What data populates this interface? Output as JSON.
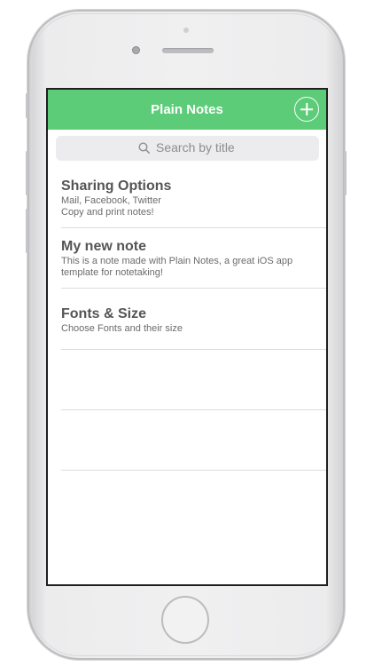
{
  "app": {
    "title": "Plain Notes"
  },
  "search": {
    "placeholder": "Search by title"
  },
  "notes": [
    {
      "title": "Sharing Options",
      "lines": [
        "Mail, Facebook, Twitter",
        "Copy and print notes!"
      ]
    },
    {
      "title": "My new note",
      "lines": [
        "This is a note made with Plain Notes, a great iOS app",
        "template for notetaking!"
      ]
    },
    {
      "title": "Fonts & Size",
      "lines": [
        "Choose Fonts and their size"
      ]
    }
  ],
  "colors": {
    "navbar": "#5ccc79",
    "title_text": "#ffffff",
    "separator": "#dcdcde"
  },
  "icons": {
    "add": "plus-circle-icon",
    "search": "search-icon"
  }
}
